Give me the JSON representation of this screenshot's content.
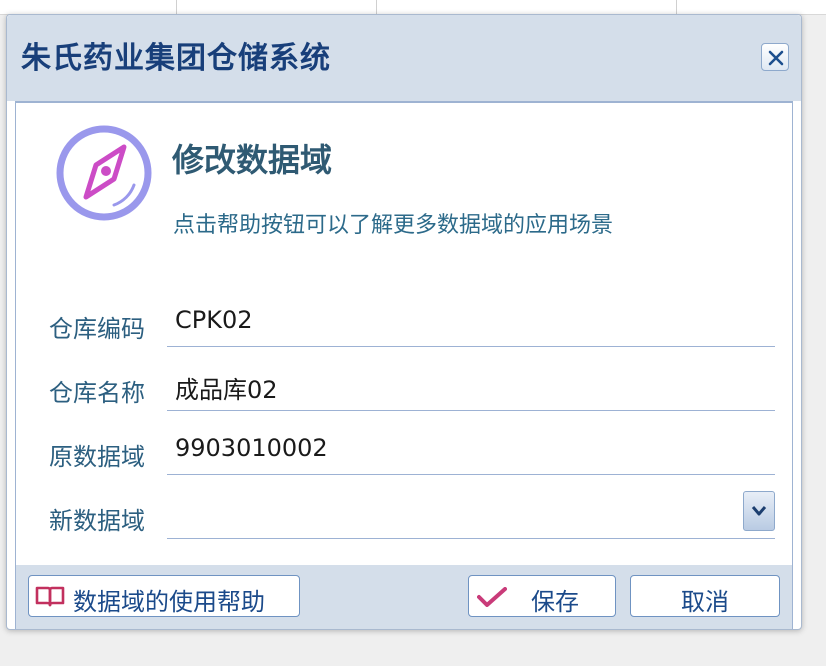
{
  "app": {
    "title": "朱氏药业集团仓储系统"
  },
  "dialog": {
    "title": "修改数据域",
    "subtitle": "点击帮助按钮可以了解更多数据域的应用场景"
  },
  "form": {
    "fields": [
      {
        "label": "仓库编码",
        "value": "CPK02"
      },
      {
        "label": "仓库名称",
        "value": "成品库02"
      },
      {
        "label": "原数据域",
        "value": "9903010002"
      },
      {
        "label": "新数据域",
        "value": ""
      }
    ]
  },
  "footer": {
    "help_label": "数据域的使用帮助",
    "save_label": "保存",
    "cancel_label": "取消"
  },
  "colors": {
    "accent": "#183f7a",
    "titlebar_bg": "#d4deea",
    "icon_purple": "#9a98ec",
    "icon_pink": "#cc4cc6",
    "book_icon": "#c2305e",
    "check_icon": "#c93b79"
  },
  "icons": {
    "header": "compass-icon",
    "close": "close-icon",
    "dropdown": "chevron-down-icon",
    "help": "book-icon",
    "save": "checkmark-icon"
  }
}
